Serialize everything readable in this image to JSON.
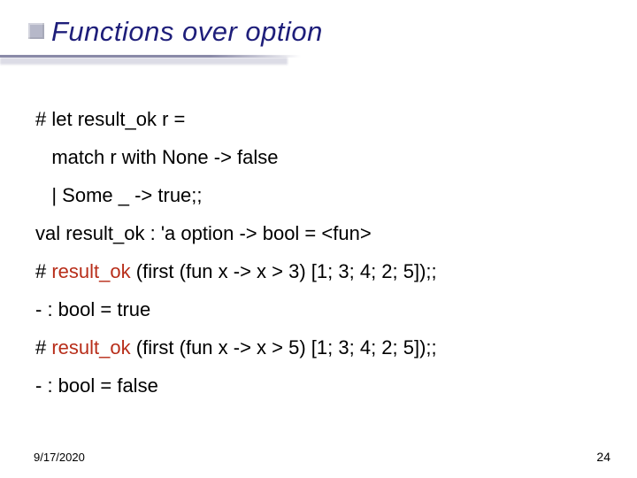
{
  "title": "Functions over option",
  "code": {
    "l1": "# let result_ok r =",
    "l2": "   match r with None -> false",
    "l3": "   | Some _ -> true;;",
    "l4": "val result_ok : 'a option -> bool = <fun>",
    "l5a": "# ",
    "l5b": "result_ok",
    "l5c": " (first (fun x -> x > 3) [1; 3; 4; 2; 5]);;",
    "l6": "- : bool = true",
    "l7a": "# ",
    "l7b": "result_ok",
    "l7c": " (first (fun x -> x > 5) [1; 3; 4; 2; 5]);;",
    "l8": "- : bool = false"
  },
  "footer": {
    "date": "9/17/2020",
    "page": "24"
  }
}
